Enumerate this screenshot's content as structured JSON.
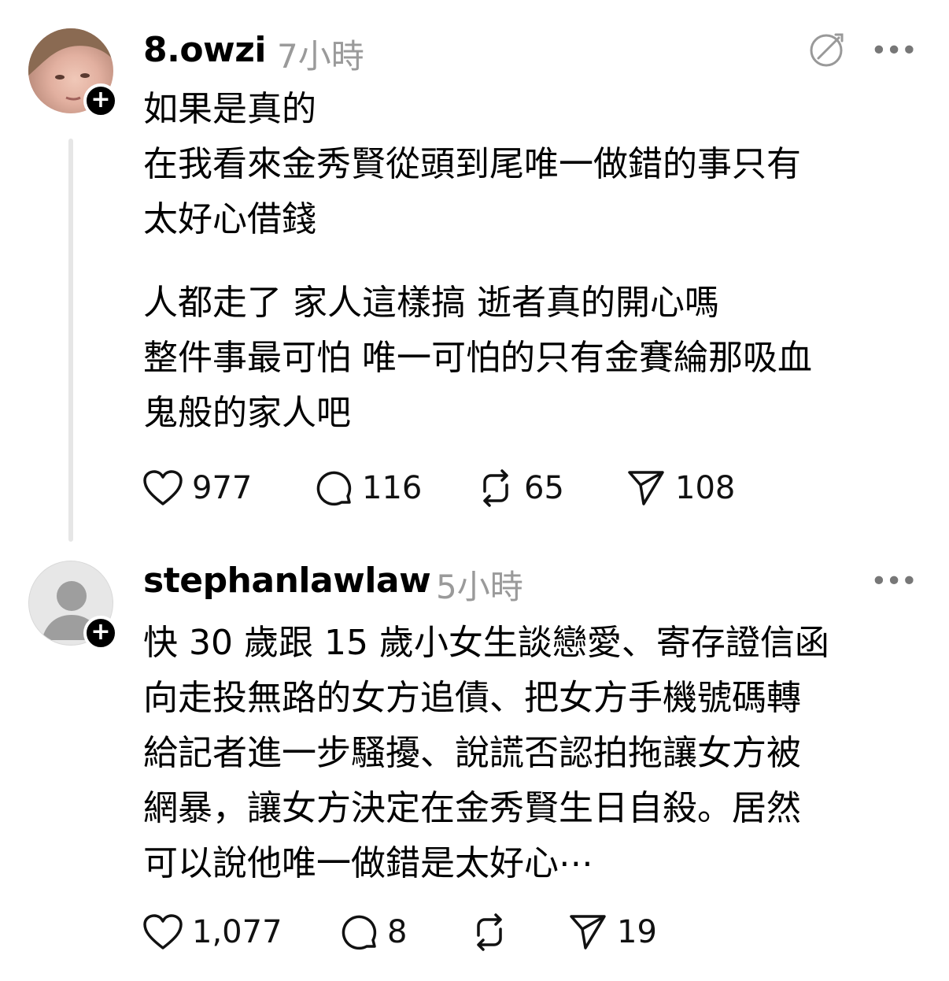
{
  "posts": [
    {
      "username": "8.owzi",
      "time": "7小時",
      "paragraphs": [
        [
          "如果是真的",
          "在我看來金秀賢從頭到尾唯一做錯的事只有",
          "太好心借錢"
        ],
        [
          "人都走了 家人這樣搞 逝者真的開心嗎",
          "整件事最可怕 唯一可怕的只有金賽綸那吸血",
          "鬼般的家人吧"
        ]
      ],
      "actions": {
        "likes": "977",
        "replies": "116",
        "reposts": "65",
        "shares": "108"
      }
    },
    {
      "username": "stephanlawlaw",
      "time": "5小時",
      "paragraphs": [
        [
          "快 30 歲跟 15 歲小女生談戀愛、寄存證信函",
          "向走投無路的女方追債、把女方手機號碼轉",
          "給記者進一步騷擾、說謊否認拍拖讓女方被",
          "網暴，讓女方決定在金秀賢生日自殺。居然",
          "可以說他唯一做錯是太好心⋯"
        ]
      ],
      "actions": {
        "likes": "1,077",
        "replies": "8",
        "reposts": "",
        "shares": "19"
      }
    }
  ],
  "icons": {
    "follow": "plus-icon",
    "more": "more-icon",
    "translate": "translate-icon",
    "like": "heart-icon",
    "reply": "comment-icon",
    "repost": "repost-icon",
    "share": "send-icon"
  },
  "glyphs": {
    "more": "•••",
    "follow": "+"
  }
}
